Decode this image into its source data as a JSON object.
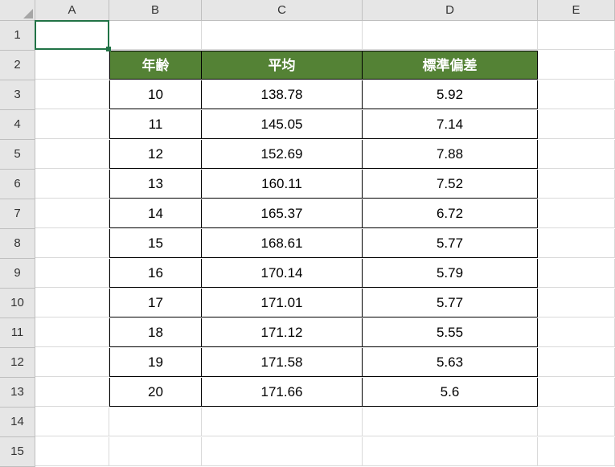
{
  "columns": [
    "A",
    "B",
    "C",
    "D",
    "E"
  ],
  "row_numbers": [
    1,
    2,
    3,
    4,
    5,
    6,
    7,
    8,
    9,
    10,
    11,
    12,
    13,
    14,
    15
  ],
  "selected_cell": "A1",
  "table": {
    "headers": [
      "年齢",
      "平均",
      "標準偏差"
    ],
    "rows": [
      {
        "age": 10,
        "mean": 138.78,
        "stdev": 5.92
      },
      {
        "age": 11,
        "mean": 145.05,
        "stdev": 7.14
      },
      {
        "age": 12,
        "mean": 152.69,
        "stdev": 7.88
      },
      {
        "age": 13,
        "mean": 160.11,
        "stdev": 7.52
      },
      {
        "age": 14,
        "mean": 165.37,
        "stdev": 6.72
      },
      {
        "age": 15,
        "mean": 168.61,
        "stdev": 5.77
      },
      {
        "age": 16,
        "mean": 170.14,
        "stdev": 5.79
      },
      {
        "age": 17,
        "mean": 171.01,
        "stdev": 5.77
      },
      {
        "age": 18,
        "mean": 171.12,
        "stdev": 5.55
      },
      {
        "age": 19,
        "mean": 171.58,
        "stdev": 5.63
      },
      {
        "age": 20,
        "mean": 171.66,
        "stdev": 5.6
      }
    ]
  }
}
